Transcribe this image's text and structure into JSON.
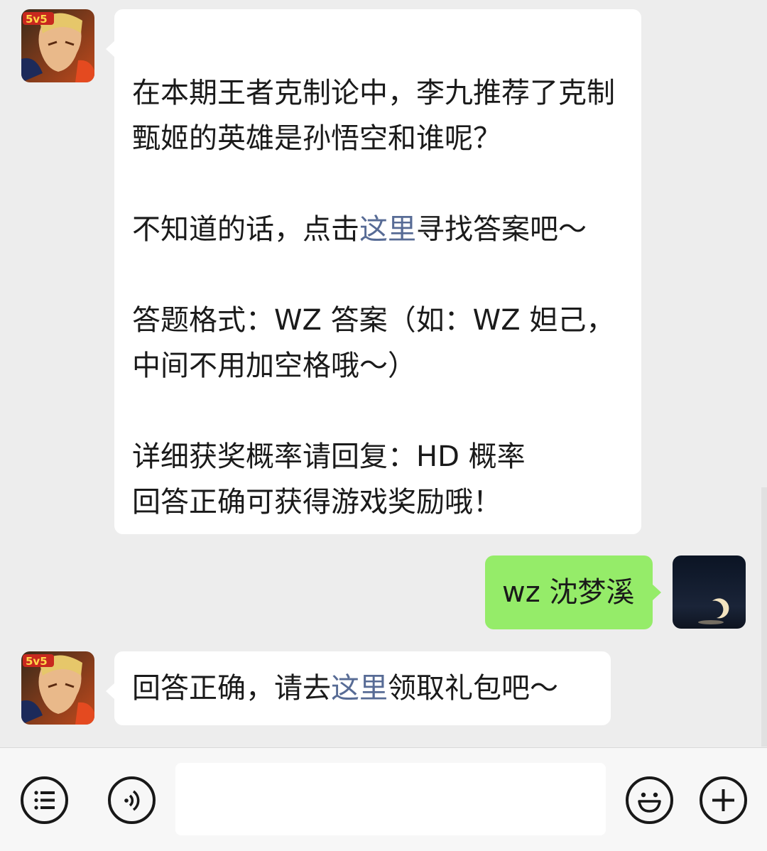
{
  "messages": [
    {
      "side": "incoming",
      "avatar": "5v5-game-hero-avatar",
      "paragraphs": [
        "在本期王者克制论中，李九推荐了克制甄姬的英雄是孙悟空和谁呢？",
        "",
        "不知道的话，点击|这里|寻找答案吧～",
        "",
        "答题格式：WZ 答案（如：WZ 妲己，中间不用加空格哦～）",
        "",
        "详细获奖概率请回复：HD 概率",
        "回答正确可获得游戏奖励哦！"
      ],
      "text": {
        "line1": "在本期王者克制论中，李九推荐了克制甄姬的英雄是孙悟空和谁呢？",
        "line2_pre": "不知道的话，点击",
        "line2_link": "这里",
        "line2_post": "寻找答案吧～",
        "line3": "答题格式：WZ 答案（如：WZ 妲己，中间不用加空格哦～）",
        "line4": "详细获奖概率请回复：HD 概率",
        "line5": "回答正确可获得游戏奖励哦！"
      }
    },
    {
      "side": "outgoing",
      "avatar": "moon-night-avatar",
      "text": "wz 沈梦溪"
    },
    {
      "side": "incoming",
      "avatar": "5v5-game-hero-avatar",
      "text": {
        "pre": "回答正确，请去",
        "link": "这里",
        "post": "领取礼包吧～"
      }
    }
  ],
  "colors": {
    "background": "#ededed",
    "incoming_bubble": "#ffffff",
    "outgoing_bubble": "#95ec69",
    "link": "#576b95"
  },
  "toolbar": {
    "icons": [
      "menu-list-icon",
      "voice-icon",
      "emoji-icon",
      "plus-icon"
    ],
    "input_value": ""
  }
}
